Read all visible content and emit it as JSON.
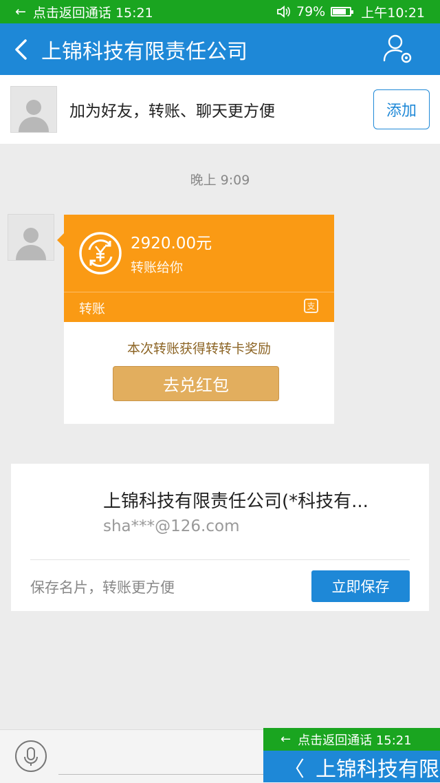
{
  "status_bar": {
    "call_text": "点击返回通话 15:21",
    "battery": "79%",
    "battery_level": 0.79,
    "clock": "上午10:21"
  },
  "header": {
    "title": "上锦科技有限责任公司"
  },
  "friend_bar": {
    "text": "加为好友，转账、聊天更方便",
    "add_label": "添加"
  },
  "timestamp": "晚上 9:09",
  "transfer": {
    "amount": "2920.00元",
    "subtitle": "转账给你",
    "type_label": "转账",
    "reward_text": "本次转账获得转转卡奖励",
    "redeem_label": "去兑红包"
  },
  "contact_card": {
    "name": "上锦科技有限责任公司(*科技有...",
    "email": "sha***@126.com",
    "tip": "保存名片，转账更方便",
    "save_label": "立即保存"
  },
  "overlay": {
    "call_text": "点击返回通话 15:21",
    "title_fragment": "上锦科技有限"
  },
  "colors": {
    "status_green": "#1aa520",
    "header_blue": "#1e88d7",
    "transfer_orange": "#fa9a14",
    "redeem_gold": "#e2ae5e"
  }
}
